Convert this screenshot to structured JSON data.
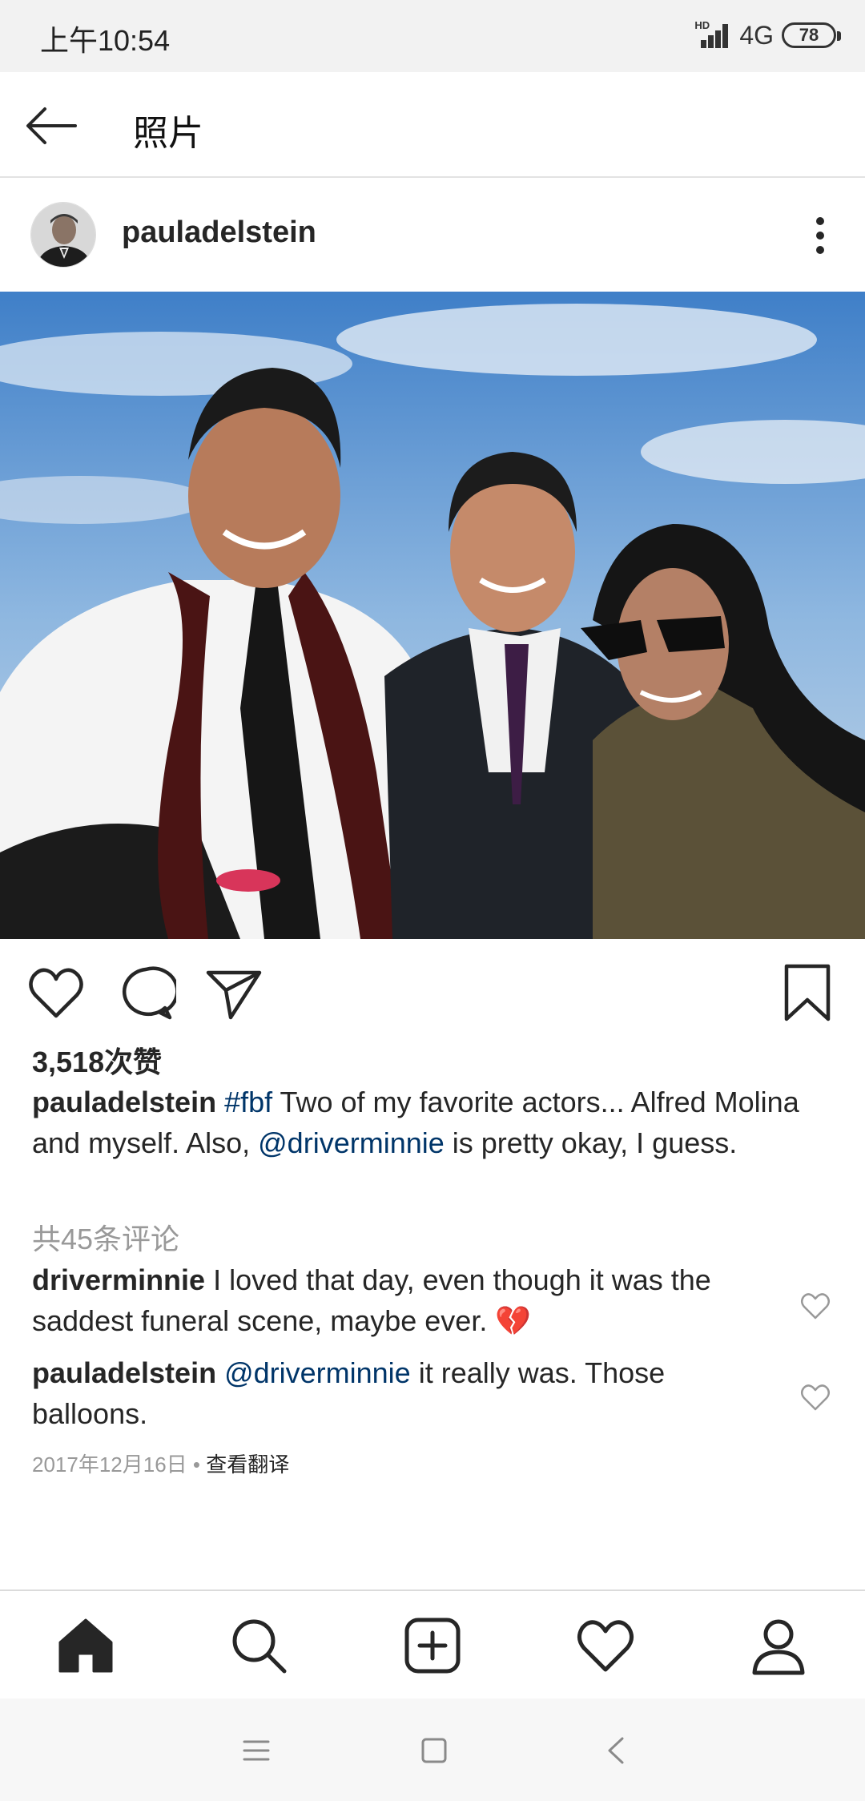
{
  "status_bar": {
    "time": "上午10:54",
    "hd_label": "HD",
    "network": "4G",
    "battery": "78"
  },
  "header": {
    "back_icon": "arrow-left-icon",
    "title": "照片"
  },
  "post": {
    "username": "pauladelstein",
    "more_icon": "more-vertical-icon",
    "likes": "3,518次赞",
    "caption": {
      "username": "pauladelstein",
      "hashtag": "#fbf",
      "text_1": " Two of my favorite actors... Alfred Molina and myself. Also, ",
      "mention": "@driverminnie",
      "text_2": " is pretty okay, I guess."
    },
    "view_comments": "共45条评论",
    "comments": [
      {
        "username": "driverminnie",
        "text": " I loved that day, even though it was the saddest funeral scene, maybe ever. ",
        "emoji": "💔"
      },
      {
        "username": "pauladelstein",
        "mention": "@driverminnie",
        "text": " it really was. Those balloons."
      }
    ],
    "date": "2017年12月16日",
    "separator": " • ",
    "translate": "查看翻译"
  },
  "actions": {
    "like_icon": "heart-icon",
    "comment_icon": "comment-icon",
    "share_icon": "send-icon",
    "save_icon": "bookmark-icon"
  },
  "tab_bar": {
    "items": [
      "home-icon",
      "search-icon",
      "add-post-icon",
      "activity-heart-icon",
      "profile-icon"
    ],
    "active": "home-icon"
  },
  "nav_bar": {
    "items": [
      "menu-icon",
      "home-square-icon",
      "back-chevron-icon"
    ]
  },
  "colors": {
    "link": "#003569",
    "muted": "#999999",
    "text": "#262626",
    "status_bg": "#f2f2f2"
  }
}
